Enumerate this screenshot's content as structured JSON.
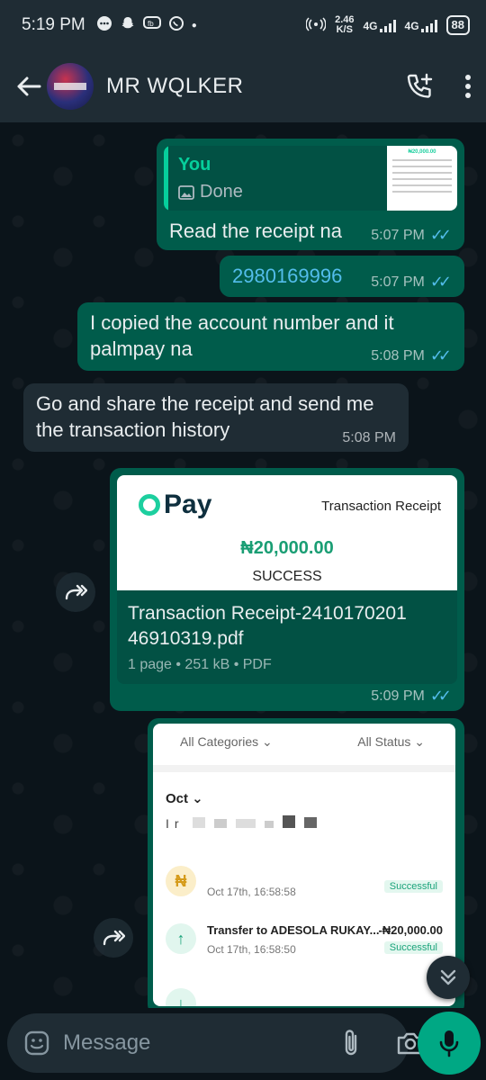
{
  "status_bar": {
    "time": "5:19 PM",
    "net_speed_value": "2.46",
    "net_speed_unit": "K/S",
    "net_type_1": "4G",
    "net_type_2": "4G",
    "battery": "88",
    "notif_icons": [
      "chat-icon",
      "snapchat-icon",
      "messenger-icon",
      "whatsapp-icon"
    ]
  },
  "header": {
    "contact_name": "MR WQLKER"
  },
  "messages": [
    {
      "direction": "outgoing",
      "quote": {
        "author": "You",
        "snippet": "Done"
      },
      "text": "Read the receipt na",
      "time": "5:07 PM",
      "read": true
    },
    {
      "direction": "outgoing",
      "text": "2980169996",
      "time": "5:07 PM",
      "read": true,
      "text_color": "#53bdeb"
    },
    {
      "direction": "outgoing",
      "text": "I copied the account number and it palmpay na",
      "time": "5:08 PM",
      "read": true
    },
    {
      "direction": "incoming",
      "text": "Go and share the receipt and send me the transaction history",
      "time": "5:08 PM"
    },
    {
      "direction": "outgoing",
      "type": "document",
      "preview": {
        "brand": "Pay",
        "label": "Transaction Receipt",
        "amount": "₦20,000.00",
        "status": "SUCCESS"
      },
      "file_name": "Transaction Receipt-2410170201 46910319.pdf",
      "file_info": "1 page • 251 kB • PDF",
      "time": "5:09 PM",
      "read": true
    },
    {
      "direction": "outgoing",
      "type": "image",
      "screenshot": {
        "filter_1": "All Categories",
        "filter_2": "All Status",
        "month": "Oct",
        "blurred_prefix": "Ir",
        "rows": [
          {
            "title": "",
            "date": "Oct 17th, 16:58:58",
            "amount": "",
            "status": "Successful"
          },
          {
            "title": "Transfer to ADESOLA RUKAY...",
            "date": "Oct 17th, 16:58:50",
            "amount": "-₦20,000.00",
            "status": "Successful"
          }
        ]
      }
    }
  ],
  "composer": {
    "placeholder": "Message"
  },
  "colors": {
    "outgoing_bubble": "#005c4b",
    "incoming_bubble": "#1f2c34",
    "read_ticks": "#53bdeb",
    "accent": "#00a884"
  }
}
